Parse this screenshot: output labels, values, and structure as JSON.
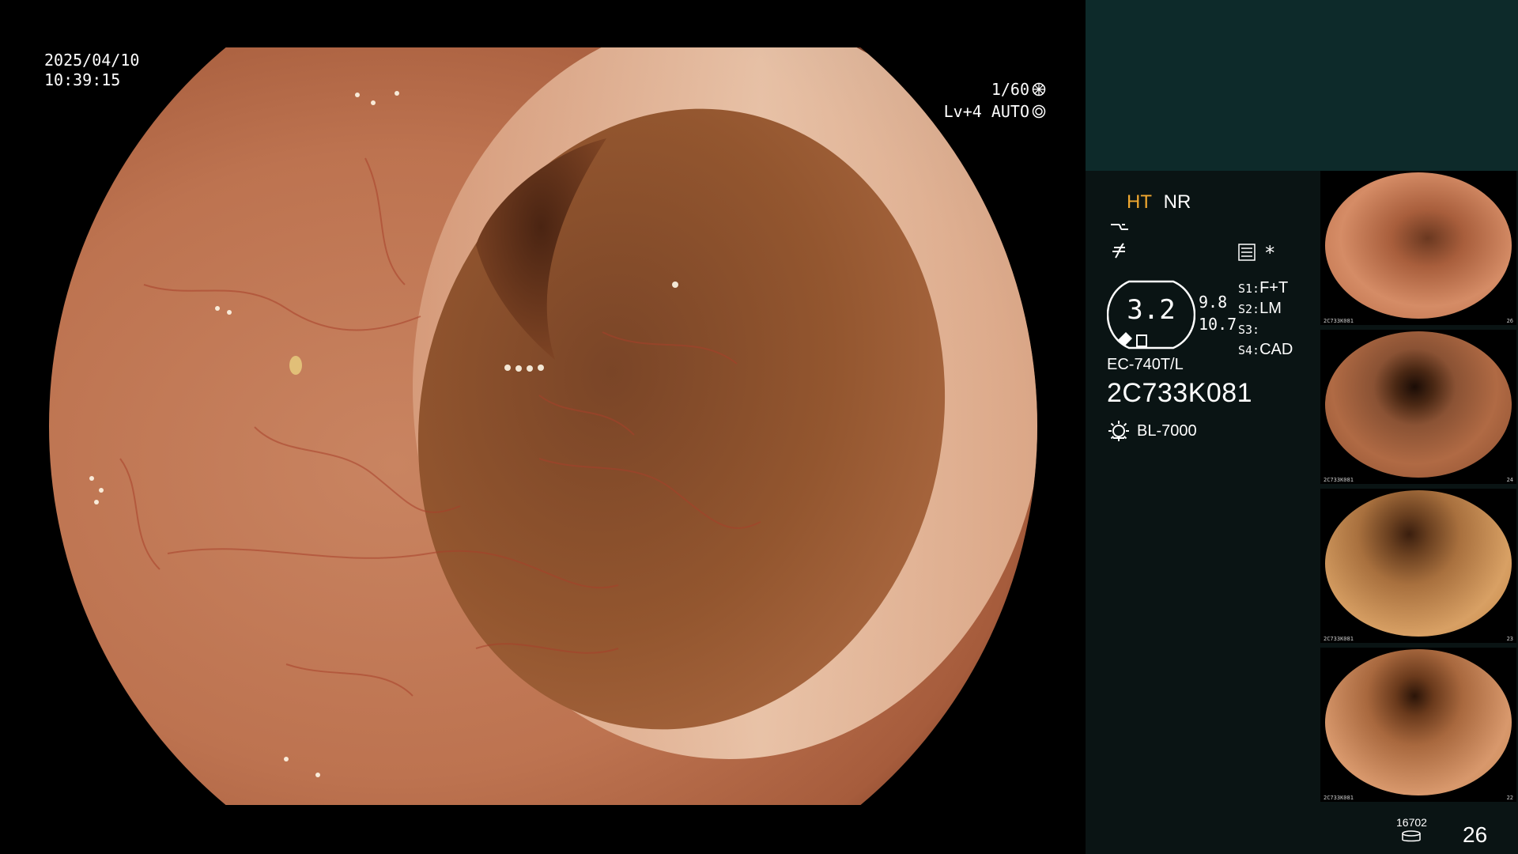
{
  "overlay": {
    "date": "2025/04/10",
    "time": "10:39:15",
    "shutter": "1/60",
    "level": "Lv+4 AUTO"
  },
  "info": {
    "mode_ht": "HT",
    "mode_nr": "NR",
    "gauge_value": "3.2",
    "gauge_side_top": "9.8",
    "gauge_side_bottom": "10.7",
    "s_keys": [
      "S1:",
      "S2:",
      "S3:",
      "S4:"
    ],
    "s_values": [
      "F+T",
      "LM",
      "",
      "CAD"
    ],
    "model": "EC-740T/L",
    "serial": "2C733K081",
    "light_source": "BL-7000"
  },
  "thumbnails": [
    {
      "name": "thumb-1",
      "label": "2C733K081",
      "index": "26"
    },
    {
      "name": "thumb-2",
      "label": "2C733K081",
      "index": "24"
    },
    {
      "name": "thumb-3",
      "label": "2C733K081",
      "index": "23"
    },
    {
      "name": "thumb-4",
      "label": "2C733K081",
      "index": "22"
    }
  ],
  "counter": {
    "small": "16702",
    "big": "26"
  },
  "colors": {
    "panel_bg": "#0a1414",
    "panel_header": "#0d2a2a",
    "accent_ht": "#f0a830"
  },
  "icons": [
    "shutter-icon",
    "auto-iris-icon",
    "structure-icon",
    "color-icon",
    "menu-icon",
    "light-source-icon",
    "storage-icon"
  ]
}
